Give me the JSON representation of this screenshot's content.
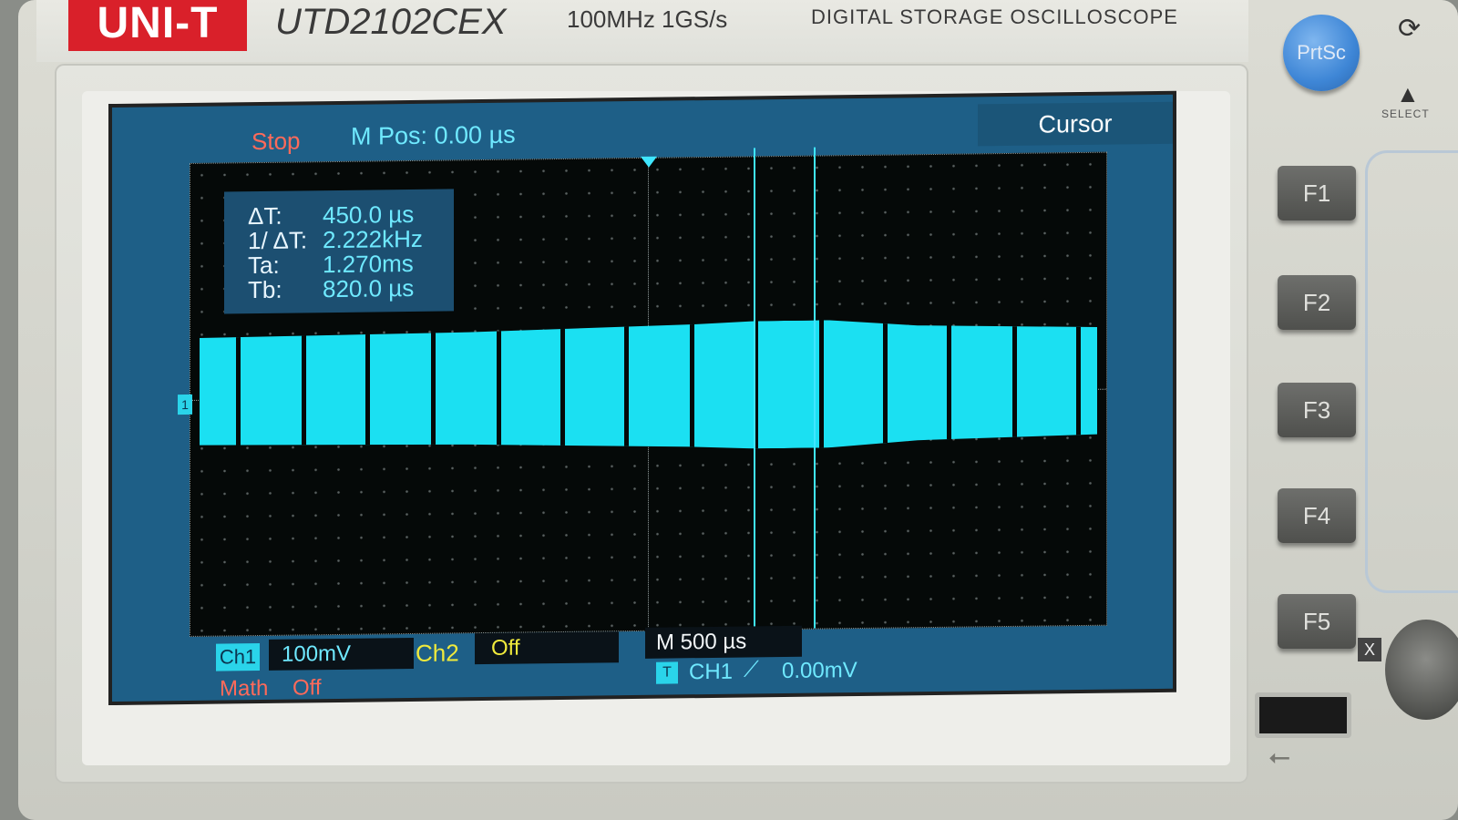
{
  "device": {
    "brand": "UNI-T",
    "model": "UTD2102CEX",
    "spec": "100MHz  1GS/s",
    "description": "DIGITAL STORAGE OSCILLOSCOPE"
  },
  "screen": {
    "run_state": "Stop",
    "memory_position": "M Pos: 0.00 µs",
    "menu_title": "Cursor",
    "channel_marker": "1",
    "cursor_readout": {
      "delta_t_label": "ΔT:",
      "delta_t_value": "450.0 µs",
      "inv_delta_t_label": "1/ ΔT:",
      "inv_delta_t_value": "2.222kHz",
      "ta_label": "Ta:",
      "ta_value": "1.270ms",
      "tb_label": "Tb:",
      "tb_value": "820.0 µs"
    },
    "bottom": {
      "ch1_tag": "Ch1",
      "ch1_scale": "100mV",
      "ch2_tag": "Ch2",
      "ch2_state": "Off",
      "timebase": "M 500 µs",
      "trigger_icon": "T",
      "trigger_source": "CH1",
      "trigger_edge": "⟋",
      "trigger_level": "0.00mV",
      "math_label": "Math",
      "math_state": "Off"
    },
    "colors": {
      "ch1": "#1be0f2",
      "status_stop": "#ff6a5a",
      "ch2": "#f0ea3c"
    }
  },
  "panel": {
    "prtsc_label": "PrtSc",
    "select_label": "SELECT",
    "f_keys": [
      "F1",
      "F2",
      "F3",
      "F4",
      "F5"
    ],
    "x_label": "X"
  }
}
